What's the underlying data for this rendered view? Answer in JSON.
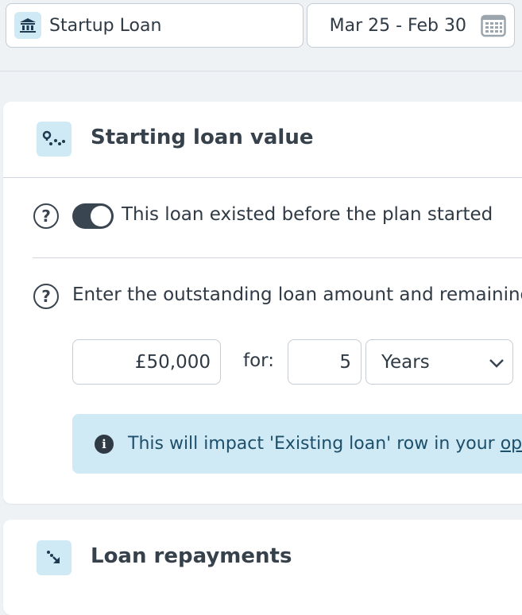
{
  "header": {
    "loan_name": "Startup Loan",
    "loan_icon": "bank-icon",
    "date_range": "Mar 25 - Feb 30",
    "date_icon": "calendar-icon"
  },
  "starting_loan": {
    "title": "Starting loan value",
    "icon": "route-icon",
    "existed_toggle": {
      "label": "This loan existed before the plan started",
      "on": true
    },
    "outstanding": {
      "label": "Enter the outstanding loan amount and remaining",
      "amount": "£50,000",
      "for_label": "for:",
      "term": "5",
      "unit": "Years"
    },
    "info": {
      "text": "This will impact 'Existing loan' row in your ",
      "link": "op"
    }
  },
  "repayments": {
    "title": "Loan repayments",
    "icon": "arrow-down-right-icon"
  },
  "colors": {
    "accent_bg": "#cfeaf5",
    "toggle_on": "#3a4552",
    "text": "#2f3a45"
  }
}
